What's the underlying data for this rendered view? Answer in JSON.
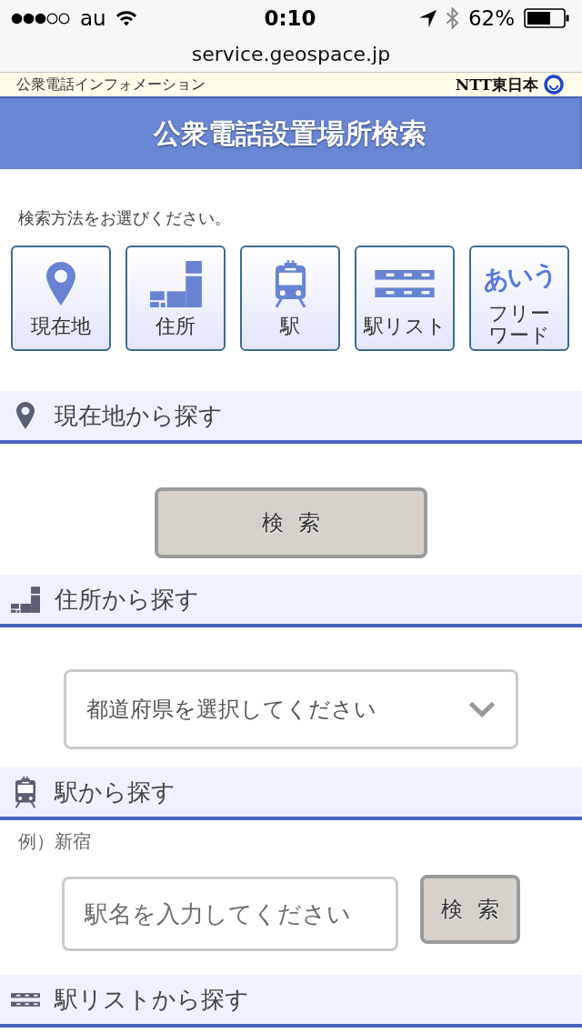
{
  "status_bar": {
    "carrier": "au",
    "time": "0:10",
    "battery": "62%"
  },
  "address_bar": {
    "url": "service.geospace.jp"
  },
  "banner": {
    "title": "公衆電話インフォメーション",
    "logo_text": "NTT東日本"
  },
  "page_title": "公衆電話設置場所検索",
  "intro": "検索方法をお選びください。",
  "methods": [
    {
      "kind": "location",
      "label": "現在地"
    },
    {
      "kind": "address",
      "label": "住所"
    },
    {
      "kind": "station",
      "label": "駅"
    },
    {
      "kind": "station_list",
      "label": "駅リスト"
    },
    {
      "kind": "free_word",
      "label": "フリーワード",
      "icon_text": "あいう"
    }
  ],
  "sections": [
    {
      "kind": "location",
      "title": "現在地から探す",
      "button": "検 索"
    },
    {
      "kind": "address",
      "title": "住所から探す",
      "select": {
        "value": "都道府県を選択してください"
      }
    },
    {
      "kind": "station",
      "title": "駅から探す",
      "hint": "例）新宿",
      "input": {
        "placeholder": "駅名を入力してください"
      },
      "button": "検 索"
    },
    {
      "kind": "station_list",
      "title": "駅リストから探す"
    }
  ]
}
